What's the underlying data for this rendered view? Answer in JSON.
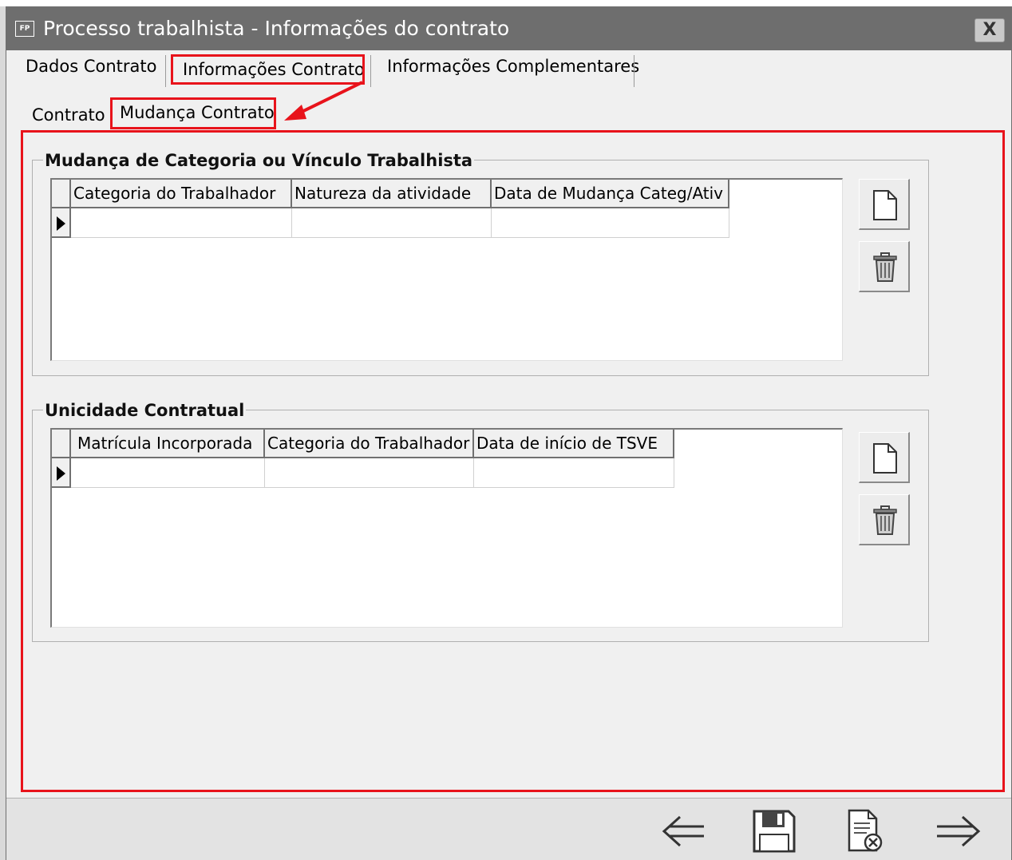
{
  "window": {
    "app_icon_text": "FP",
    "title": "Processo trabalhista - Informações do contrato",
    "close_symbol": "X"
  },
  "tabs": [
    {
      "label": "Dados Contrato"
    },
    {
      "label": "Informações Contrato"
    },
    {
      "label": "Informações Complementares"
    }
  ],
  "subtabs": [
    {
      "label": "Contrato"
    },
    {
      "label": "Mudança Contrato"
    }
  ],
  "groups": {
    "mudanca": {
      "title": "Mudança de Categoria ou Vínculo Trabalhista",
      "columns": [
        "Categoria do Trabalhador",
        "Natureza da atividade",
        "Data de Mudança Categ/Ativ"
      ]
    },
    "unicidade": {
      "title": "Unicidade Contratual",
      "columns": [
        "Matrícula Incorporada",
        "Categoria do Trabalhador",
        "Data de início de TSVE"
      ]
    }
  },
  "icons": {
    "new": "new-document-icon",
    "delete": "trash-icon",
    "prev": "arrow-left-icon",
    "save": "floppy-disk-icon",
    "cancel": "cancel-document-icon",
    "next": "arrow-right-icon"
  },
  "colors": {
    "titlebar": "#6e6e6e",
    "highlight": "#e8131b",
    "background": "#f0f0f0"
  }
}
